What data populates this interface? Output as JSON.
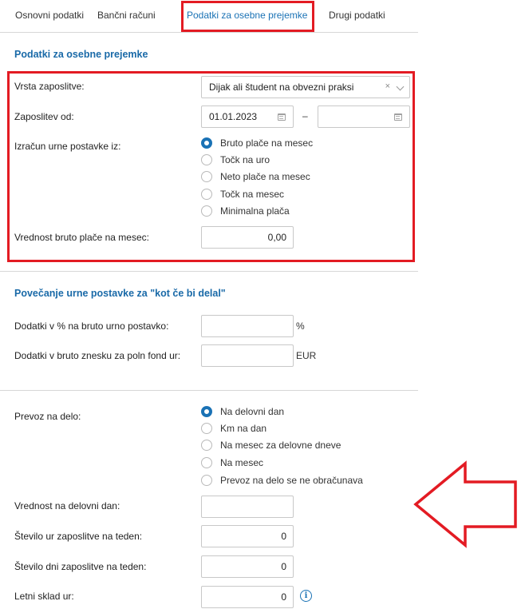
{
  "tabs": [
    {
      "label": "Osnovni podatki",
      "active": false
    },
    {
      "label": "Bančni računi",
      "active": false
    },
    {
      "label": "Podatki za osebne prejemke",
      "active": true
    },
    {
      "label": "Drugi podatki",
      "active": false
    }
  ],
  "section1": {
    "title": "Podatki za osebne prejemke",
    "employment_type": {
      "label": "Vrsta zaposlitve:",
      "value": "Dijak ali študent na obvezni praksi",
      "clear_glyph": "×"
    },
    "employment_from": {
      "label": "Zaposlitev od:",
      "from_value": "01.01.2023",
      "to_value": "",
      "separator": "–"
    },
    "hourly_rate_from": {
      "label": "Izračun urne postavke iz:",
      "options": [
        "Bruto plače na mesec",
        "Točk na uro",
        "Neto plače na mesec",
        "Točk na mesec",
        "Minimalna plača"
      ],
      "selected": "Bruto plače na mesec"
    },
    "gross_salary": {
      "label": "Vrednost bruto plače na mesec:",
      "value": "0,00"
    }
  },
  "section2": {
    "title": "Povečanje urne postavke za \"kot če bi delal\"",
    "percent_addition": {
      "label": "Dodatki v % na bruto urno postavko:",
      "value": "",
      "unit": "%"
    },
    "amount_addition": {
      "label": "Dodatki v bruto znesku za poln fond ur:",
      "value": "",
      "unit": "EUR"
    }
  },
  "section3": {
    "commute": {
      "label": "Prevoz na delo:",
      "options": [
        "Na delovni dan",
        "Km na dan",
        "Na mesec za delovne dneve",
        "Na mesec",
        "Prevoz na delo se ne obračunava"
      ],
      "selected": "Na delovni dan"
    },
    "value_per_day": {
      "label": "Vrednost na delovni dan:",
      "value": ""
    },
    "hours_per_week": {
      "label": "Število ur zaposlitve na teden:",
      "value": "0"
    },
    "days_per_week": {
      "label": "Število dni zaposlitve na teden:",
      "value": "0"
    },
    "annual_hours": {
      "label": "Letni sklad ur:",
      "value": "0",
      "info_glyph": "i"
    }
  },
  "colors": {
    "accent": "#1a72b5",
    "highlight": "#e31b23",
    "section_title": "#1a6aa8"
  },
  "icons": [
    "calendar-icon",
    "clear-icon",
    "chevron-down-icon",
    "info-icon",
    "arrow-left-annotation"
  ]
}
